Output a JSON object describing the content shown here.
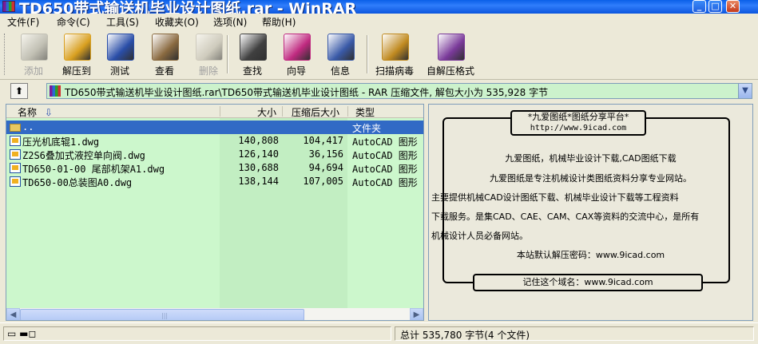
{
  "window": {
    "title": "TD650带式输送机毕业设计图纸.rar - WinRAR",
    "min": "_",
    "max": "□",
    "close": "✕"
  },
  "menu": [
    "文件(F)",
    "命令(C)",
    "工具(S)",
    "收藏夹(O)",
    "选项(N)",
    "帮助(H)"
  ],
  "toolbar": [
    {
      "label": "添加",
      "icon": "add-books-icon",
      "enabled": false,
      "color": "#a0a098"
    },
    {
      "label": "解压到",
      "icon": "extract-folder-icon",
      "enabled": true,
      "color": "#d9a020"
    },
    {
      "label": "测试",
      "icon": "test-icon",
      "enabled": true,
      "color": "#2a4ea8"
    },
    {
      "label": "查看",
      "icon": "view-glasses-icon",
      "enabled": true,
      "color": "#8a6a40"
    },
    {
      "label": "删除",
      "icon": "delete-icon",
      "enabled": false,
      "color": "#b8b4a8"
    },
    {
      "label": "查找",
      "icon": "find-binoculars-icon",
      "enabled": true,
      "color": "#404040"
    },
    {
      "label": "向导",
      "icon": "wizard-icon",
      "enabled": true,
      "color": "#c02a80"
    },
    {
      "label": "信息",
      "icon": "info-icon",
      "enabled": true,
      "color": "#3a5aa8"
    },
    {
      "label": "扫描病毒",
      "icon": "virus-scan-icon",
      "enabled": true,
      "color": "#c08a20"
    },
    {
      "label": "自解压格式",
      "icon": "sfx-icon",
      "enabled": true,
      "color": "#7a3a9a"
    }
  ],
  "address": {
    "path": "TD650带式输送机毕业设计图纸.rar\\TD650带式输送机毕业设计图纸 - RAR 压缩文件, 解包大小为 535,928 字节",
    "up": "⬆",
    "drop": "▼"
  },
  "columns": {
    "name": "名称",
    "size": "大小",
    "packed": "压缩后大小",
    "type": "类型",
    "sort": "⇩"
  },
  "files": [
    {
      "name": "..",
      "size": "",
      "packed": "",
      "type": "文件夹",
      "icon": "folder-icon",
      "selected": true
    },
    {
      "name": "压光机底辊1.dwg",
      "size": "140,808",
      "packed": "104,417",
      "type": "AutoCAD 图形",
      "icon": "dwg-file-icon",
      "selected": false
    },
    {
      "name": "Z2S6叠加式液控单向阀.dwg",
      "size": "126,140",
      "packed": "36,156",
      "type": "AutoCAD 图形",
      "icon": "dwg-file-icon",
      "selected": false
    },
    {
      "name": "TD650-01-00 尾部机架A1.dwg",
      "size": "130,688",
      "packed": "94,694",
      "type": "AutoCAD 图形",
      "icon": "dwg-file-icon",
      "selected": false
    },
    {
      "name": "TD650-00总装图A0.dwg",
      "size": "138,144",
      "packed": "107,005",
      "type": "AutoCAD 图形",
      "icon": "dwg-file-icon",
      "selected": false
    }
  ],
  "scroll": {
    "left": "◀",
    "right": "▶",
    "grip": "|||"
  },
  "comment": {
    "head1": "*九爱图纸*图纸分享平台*",
    "head2": "http://www.9icad.com",
    "lines": [
      "九爱图纸，机械毕业设计下载,CAD图纸下载",
      "九爱图纸是专注机械设计类图纸资料分享专业网站。",
      "主要提供机械CAD设计图纸下载、机械毕业设计下载等工程资料",
      "下载服务。是集CAD、CAE、CAM、CAX等资料的交流中心，是所有",
      "机械设计人员必备网站。",
      "本站默认解压密码：www.9icad.com"
    ],
    "foot": "记住这个域名：www.9icad.com"
  },
  "status": {
    "icons": "▭ ▬◻",
    "total": "总计 535,780 字节(4 个文件)"
  }
}
